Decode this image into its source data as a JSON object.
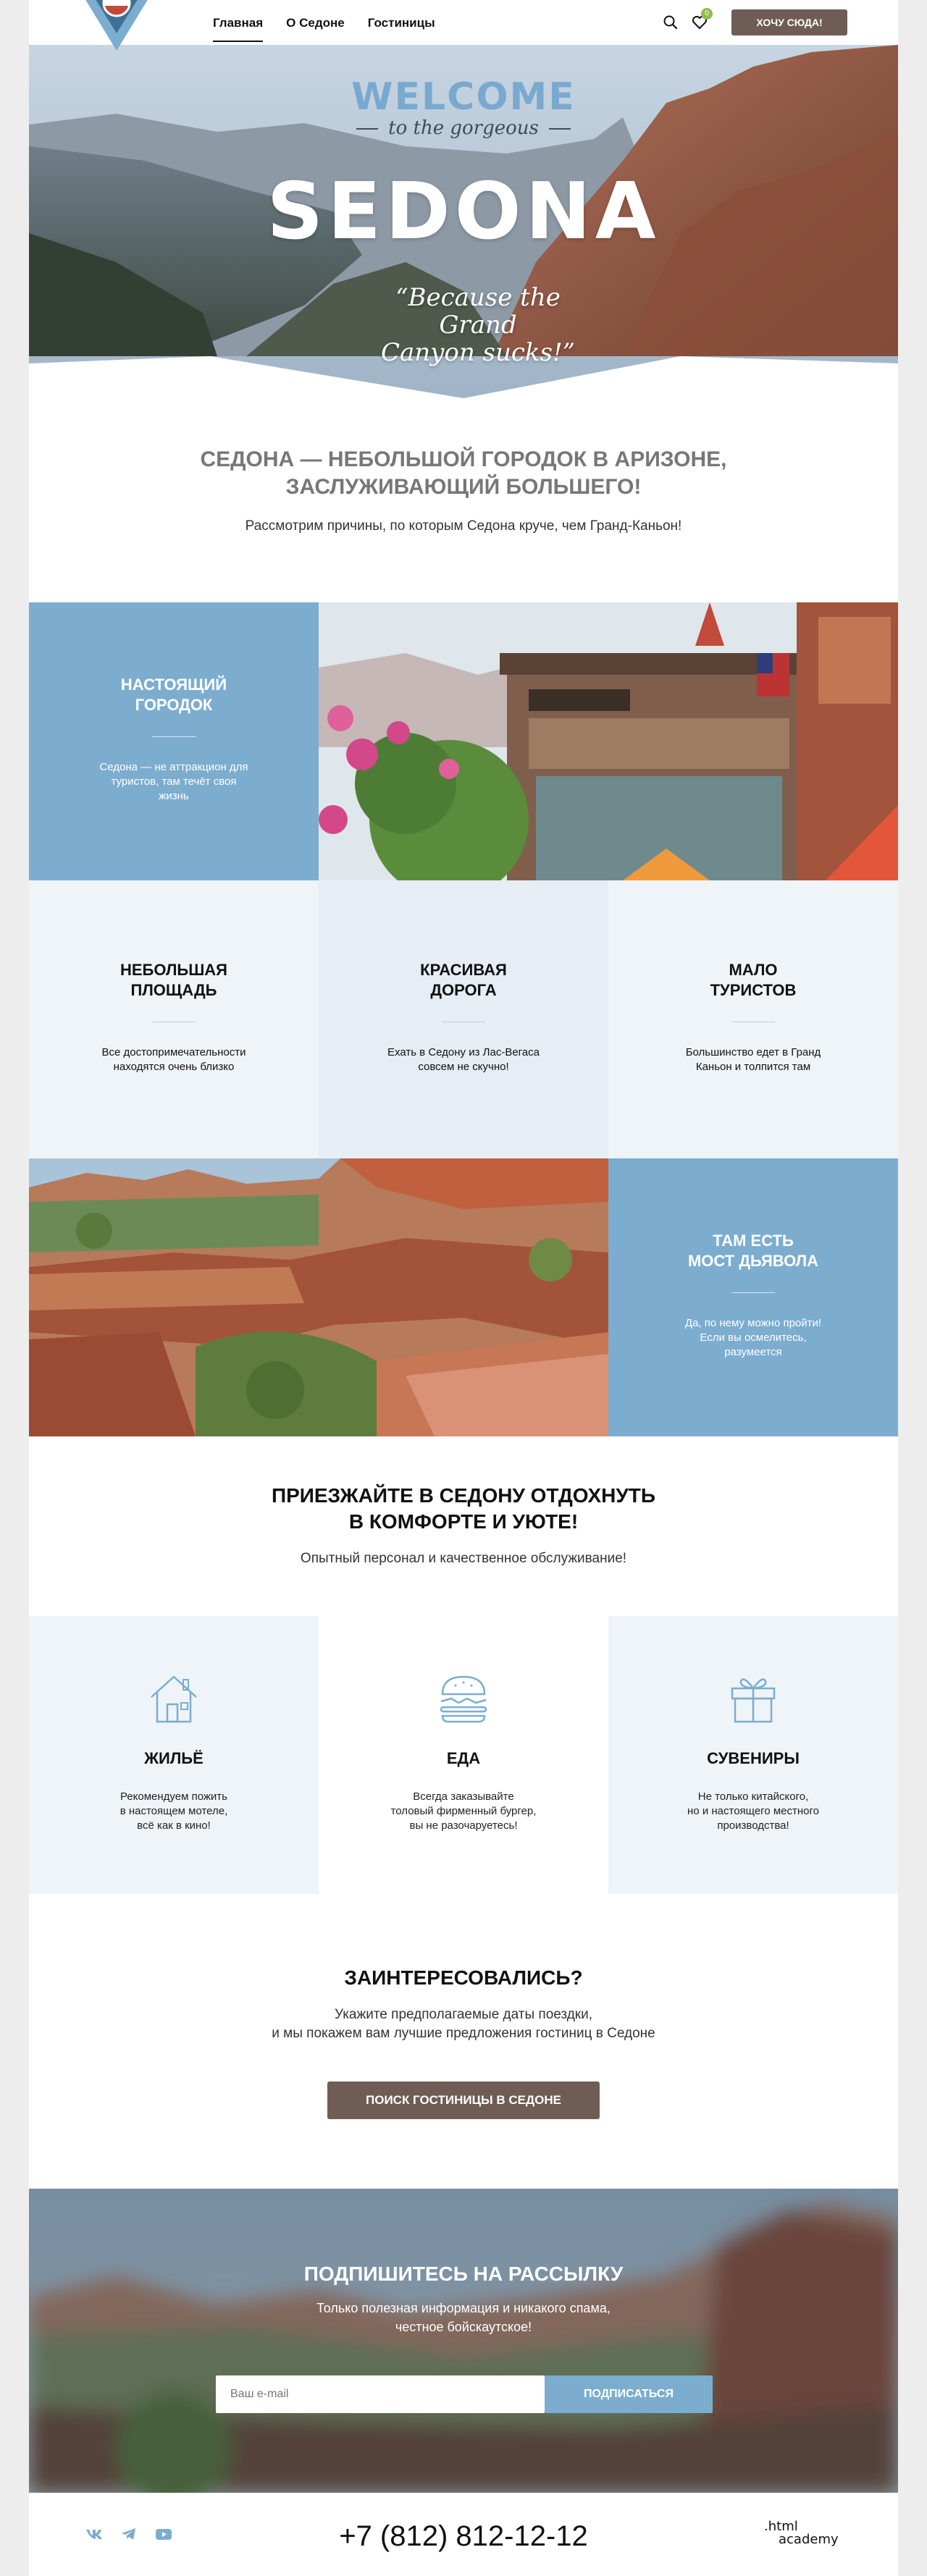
{
  "header": {
    "nav": [
      {
        "label": "Главная",
        "active": true
      },
      {
        "label": "О Седоне",
        "active": false
      },
      {
        "label": "Гостиницы",
        "active": false
      }
    ],
    "favorites_count": "0",
    "cta_label": "ХОЧУ СЮДА!"
  },
  "hero": {
    "welcome": "WELCOME",
    "to_the_gorgeous": "to the gorgeous",
    "sedona": "SEDONA",
    "quote_line1": "“Because the Grand",
    "quote_line2": "Canyon sucks!”"
  },
  "intro": {
    "title_line1": "СЕДОНА — НЕБОЛЬШОЙ ГОРОДОК В АРИЗОНЕ,",
    "title_line2": "ЗАСЛУЖИВАЮЩИЙ БОЛЬШЕГО!",
    "subtitle": "Рассмотрим причины, по которым Седона круче, чем Гранд-Каньон!"
  },
  "features_grid": {
    "real_town": {
      "title_line1": "НАСТОЯЩИЙ",
      "title_line2": "ГОРОДОК",
      "text_line1": "Седона — не аттракцион для",
      "text_line2": "туристов, там течёт своя",
      "text_line3": "жизнь"
    },
    "small_area": {
      "title_line1": "НЕБОЛЬШАЯ",
      "title_line2": "ПЛОЩАДЬ",
      "text_line1": "Все достопримечательности",
      "text_line2": "находятся очень близко"
    },
    "beautiful_road": {
      "title_line1": "КРАСИВАЯ",
      "title_line2": "ДОРОГА",
      "text_line1": "Ехать в Седону из Лас-Вегаса",
      "text_line2": "совсем не скучно!"
    },
    "few_tourists": {
      "title_line1": "МАЛО",
      "title_line2": "ТУРИСТОВ",
      "text_line1": "Большинство едет в Гранд",
      "text_line2": "Каньон и толпится там"
    },
    "devil_bridge": {
      "title_line1": "ТАМ ЕСТЬ",
      "title_line2": "МОСТ ДЬЯВОЛА",
      "text_line1": "Да, по нему можно пройти!",
      "text_line2": "Если вы осмелитесь,",
      "text_line3": "разумеется"
    }
  },
  "comfort": {
    "title_line1": "ПРИЕЗЖАЙТЕ В СЕДОНУ ОТДОХНУТЬ",
    "title_line2": "В КОМФОРТЕ И УЮТЕ!",
    "subtitle": "Опытный персонал и качественное обслуживание!",
    "items": [
      {
        "icon": "house-icon",
        "title": "ЖИЛЬЁ",
        "text_line1": "Рекомендуем пожить",
        "text_line2": "в настоящем мотеле,",
        "text_line3": "всё как в кино!"
      },
      {
        "icon": "burger-icon",
        "title": "ЕДА",
        "text_line1": "Всегда заказывайте",
        "text_line2": "толовый фирменный бургер,",
        "text_line3": "вы не разочаруетесь!"
      },
      {
        "icon": "gift-icon",
        "title": "СУВЕНИРЫ",
        "text_line1": "Не только китайского,",
        "text_line2": "но и настоящего местного",
        "text_line3": "производства!"
      }
    ]
  },
  "interested": {
    "title": "ЗАИНТЕРЕСОВАЛИСЬ?",
    "text_line1": "Укажите предполагаемые даты поездки,",
    "text_line2": "и мы покажем вам лучшие предложения гостиниц в Седоне",
    "button_label": "ПОИСК ГОСТИНИЦЫ В СЕДОНЕ"
  },
  "subscribe": {
    "title": "ПОДПИШИТЕСЬ НА РАССЫЛКУ",
    "text_line1": "Только полезная информация и никакого спама,",
    "text_line2": "честное бойскаутское!",
    "email_placeholder": "Ваш e-mail",
    "button_label": "ПОДПИСАТЬСЯ"
  },
  "footer": {
    "social": [
      "vk-icon",
      "telegram-icon",
      "youtube-icon"
    ],
    "phone": "+7 (812) 812-12-12",
    "academy_line1": ".html",
    "academy_line2": "academy"
  },
  "colors": {
    "accent_blue": "#7cadcf",
    "brown_button": "#6f5d55",
    "light_panel": "#eff4f8"
  }
}
